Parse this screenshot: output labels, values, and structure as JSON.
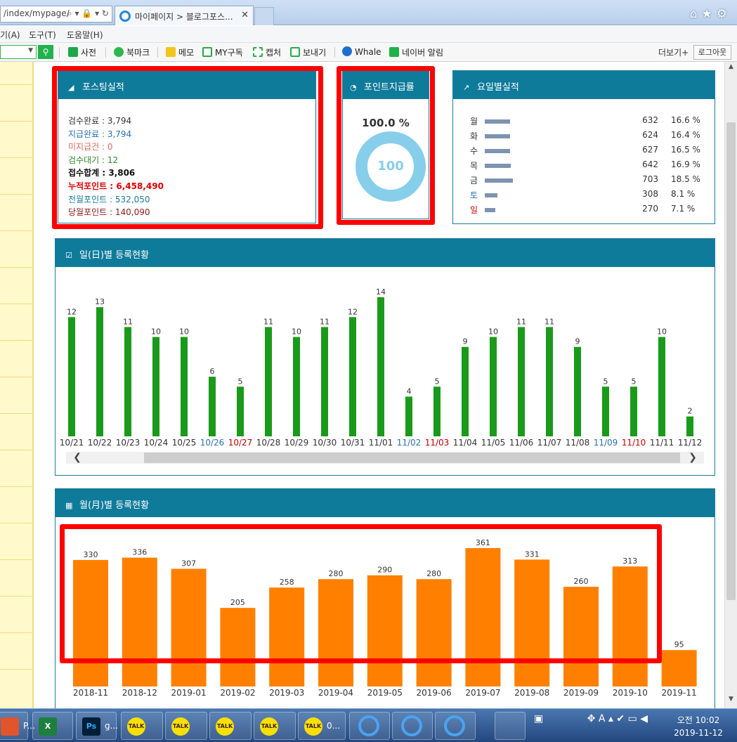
{
  "browser": {
    "address_text": "/index/mypage/",
    "tab_title": "마이페이지 > 블로그포스...",
    "tab_close": "✕",
    "address_glyphs": "⌕ ▾ 🔒 ▾ ↻"
  },
  "menubar": {
    "items": [
      "기(A)",
      "도구(T)",
      "도움말(H)"
    ]
  },
  "naver_toolbar": {
    "items": [
      "사전",
      "북마크",
      "메모",
      "MY구독",
      "캡처",
      "보내기",
      "Whale",
      "네이버 알림"
    ],
    "more": "더보기+",
    "logout": "로그아웃"
  },
  "posting_panel": {
    "title": "포스팅실적",
    "lines": [
      {
        "text": "검수완료 : 3,794",
        "color": "#333333"
      },
      {
        "text": "지급완료 : 3,794",
        "color": "#2a6fb0"
      },
      {
        "text": "미지급건 : 0",
        "color": "#e06a5a"
      },
      {
        "text": "검수대기 : 12",
        "color": "#2e8b2e"
      },
      {
        "text": "접수합계 : 3,806",
        "color": "#111111"
      },
      {
        "text": "누적포인트 : 6,458,490",
        "color": "#e00000"
      },
      {
        "text": "전월포인트 : 532,050",
        "color": "#1a7a9a"
      },
      {
        "text": "당월포인트 : 140,090",
        "color": "#8b1a1a"
      }
    ]
  },
  "point_panel": {
    "title": "포인트지급률",
    "percent_text": "100.0 %",
    "donut_value": "100",
    "donut_fraction": 1.0,
    "color": "#87ceeb"
  },
  "weekday_panel": {
    "title": "요일별실적",
    "rows": [
      {
        "day": "월",
        "count": 632,
        "count_text": "632",
        "pct": "16.6 %",
        "color": "#333333"
      },
      {
        "day": "화",
        "count": 624,
        "count_text": "624",
        "pct": "16.4 %",
        "color": "#333333"
      },
      {
        "day": "수",
        "count": 627,
        "count_text": "627",
        "pct": "16.5 %",
        "color": "#333333"
      },
      {
        "day": "목",
        "count": 642,
        "count_text": "642",
        "pct": "16.9 %",
        "color": "#333333"
      },
      {
        "day": "금",
        "count": 703,
        "count_text": "703",
        "pct": "18.5 %",
        "color": "#333333"
      },
      {
        "day": "토",
        "count": 308,
        "count_text": "308",
        "pct": "8.1 %",
        "color": "#2a6fb0"
      },
      {
        "day": "일",
        "count": 270,
        "count_text": "270",
        "pct": "7.1 %",
        "color": "#c00000"
      }
    ]
  },
  "daily_panel": {
    "title": "일(日)별 등록현황",
    "scroll_left": "❮",
    "scroll_right": "❯"
  },
  "monthly_panel": {
    "title": "월(月)별 등록현황"
  },
  "chart_data": [
    {
      "type": "bar",
      "title": "일(日)별 등록현황",
      "categories": [
        "10/21",
        "10/22",
        "10/23",
        "10/24",
        "10/25",
        "10/26",
        "10/27",
        "10/28",
        "10/29",
        "10/30",
        "10/31",
        "11/01",
        "11/02",
        "11/03",
        "11/04",
        "11/05",
        "11/06",
        "11/07",
        "11/08",
        "11/09",
        "11/10",
        "11/11",
        "11/12"
      ],
      "values": [
        12,
        13,
        11,
        10,
        10,
        6,
        5,
        11,
        10,
        11,
        12,
        14,
        4,
        5,
        9,
        10,
        11,
        11,
        9,
        5,
        5,
        10,
        2
      ],
      "label_colors": [
        "#333333",
        "#333333",
        "#333333",
        "#333333",
        "#333333",
        "#2a6fb0",
        "#c00000",
        "#333333",
        "#333333",
        "#333333",
        "#333333",
        "#333333",
        "#2a6fb0",
        "#c00000",
        "#333333",
        "#333333",
        "#333333",
        "#333333",
        "#333333",
        "#2a6fb0",
        "#c00000",
        "#333333",
        "#333333"
      ],
      "bar_color": "#1a9a1a",
      "ylim": [
        0,
        14
      ]
    },
    {
      "type": "bar",
      "title": "월(月)별 등록현황",
      "categories": [
        "2018-11",
        "2018-12",
        "2019-01",
        "2019-02",
        "2019-03",
        "2019-04",
        "2019-05",
        "2019-06",
        "2019-07",
        "2019-08",
        "2019-09",
        "2019-10",
        "2019-11"
      ],
      "values": [
        330,
        336,
        307,
        205,
        258,
        280,
        290,
        280,
        361,
        331,
        260,
        313,
        95
      ],
      "bar_color": "#ff8000",
      "ylim": [
        0,
        361
      ]
    }
  ],
  "taskbar": {
    "buttons": [
      {
        "label": "P...",
        "icon": "app-icon"
      },
      {
        "label": "",
        "icon": "excel-icon",
        "glyph": "X"
      },
      {
        "label": "g...",
        "icon": "photoshop-icon",
        "glyph": "Ps"
      },
      {
        "label": "",
        "icon": "kakaotalk-icon",
        "glyph": "TALK"
      },
      {
        "label": "",
        "icon": "kakaotalk-icon",
        "glyph": "TALK"
      },
      {
        "label": "",
        "icon": "kakaotalk-icon",
        "glyph": "TALK"
      },
      {
        "label": "",
        "icon": "kakaotalk-icon",
        "glyph": "TALK"
      },
      {
        "label": "0...",
        "icon": "kakaotalk-icon",
        "glyph": "TALK"
      }
    ],
    "tray_text": "A",
    "clock_time": "오전 10:02",
    "clock_date": "2019-11-12"
  }
}
